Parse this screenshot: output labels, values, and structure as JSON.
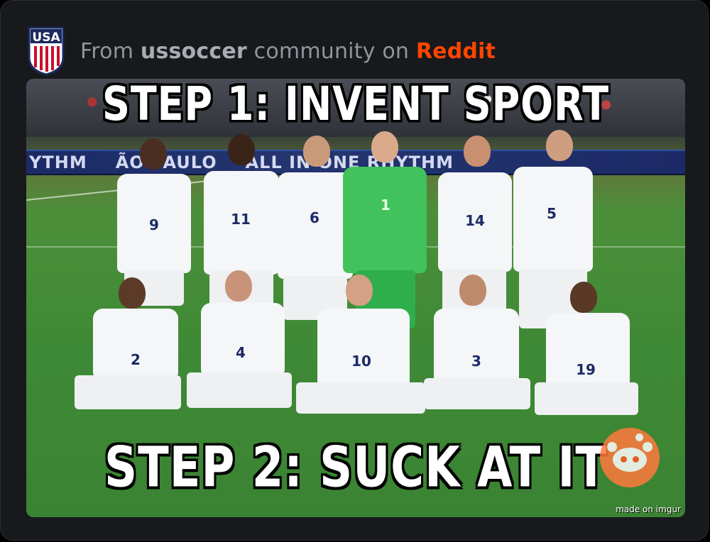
{
  "header": {
    "prefix": "From",
    "community": "ussoccer",
    "middle": "community on",
    "platform": "Reddit"
  },
  "community_logo": {
    "icon": "us-soccer-crest-icon",
    "letters": "USA"
  },
  "post_image": {
    "caption_top": "STEP 1: INVENT SPORT",
    "caption_bottom": "STEP 2: SUCK AT IT",
    "ad_board": [
      "YTHM",
      "ÃO PAULO",
      "ALL IN ONE RHYTHM"
    ],
    "watermark": "made on imgur",
    "jersey_numbers_back_row": [
      "9",
      "11",
      "6",
      "1",
      "14",
      "5"
    ],
    "jersey_numbers_front_row": [
      "2",
      "4",
      "10",
      "3",
      "19"
    ]
  },
  "reddit_badge": {
    "icon": "reddit-snoo-icon"
  },
  "colors": {
    "background": "#17191c",
    "muted_text": "#8f969c",
    "reddit_orange": "#ff4500"
  }
}
